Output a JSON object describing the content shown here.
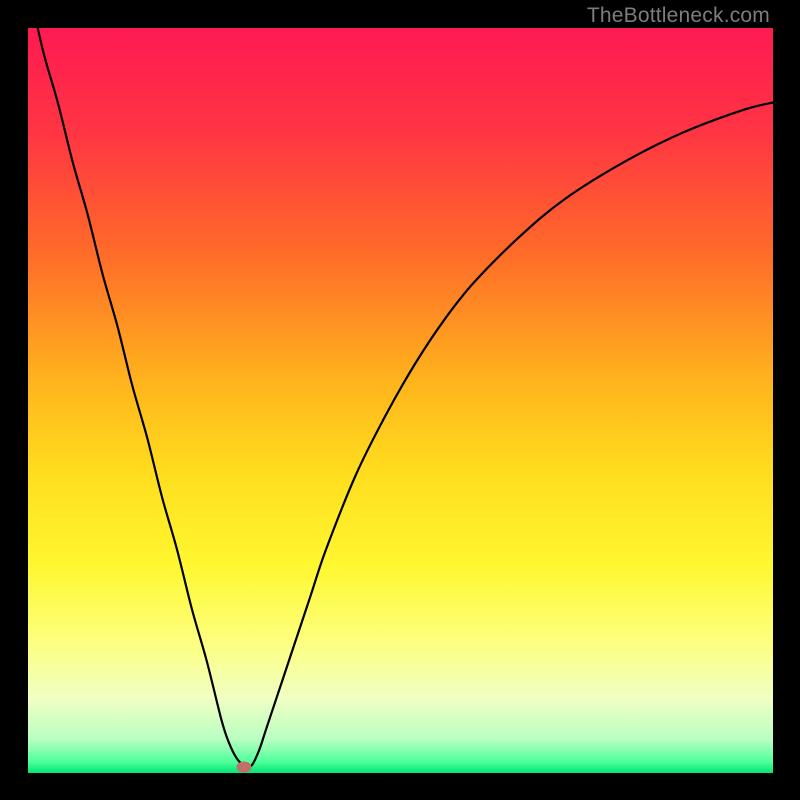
{
  "watermark": "TheBottleneck.com",
  "chart_data": {
    "type": "line",
    "title": "",
    "xlabel": "",
    "ylabel": "",
    "xlim": [
      0,
      100
    ],
    "ylim": [
      0,
      100
    ],
    "series": [
      {
        "name": "bottleneck-curve",
        "x": [
          0,
          2,
          4,
          6,
          8,
          10,
          12,
          14,
          16,
          18,
          20,
          22,
          24,
          26,
          27,
          28,
          29,
          30,
          31,
          32,
          34,
          36,
          38,
          40,
          44,
          48,
          52,
          56,
          60,
          66,
          72,
          80,
          88,
          96,
          100
        ],
        "y": [
          106,
          97,
          90,
          82,
          75,
          67,
          60,
          52,
          45,
          37,
          30,
          22,
          15,
          7,
          4,
          2,
          1,
          1,
          3,
          6,
          12,
          18,
          24,
          30,
          40,
          48,
          55,
          61,
          66,
          72,
          77,
          82,
          86,
          89,
          90
        ]
      }
    ],
    "marker": {
      "x": 29,
      "y": 0.8,
      "name": "minimum-point"
    },
    "gradient_stops": [
      {
        "offset": 0.0,
        "color": "#ff1a52"
      },
      {
        "offset": 0.14,
        "color": "#ff3543"
      },
      {
        "offset": 0.3,
        "color": "#ff6a29"
      },
      {
        "offset": 0.48,
        "color": "#ffb61c"
      },
      {
        "offset": 0.6,
        "color": "#ffde1e"
      },
      {
        "offset": 0.72,
        "color": "#fff72f"
      },
      {
        "offset": 0.82,
        "color": "#fdff7b"
      },
      {
        "offset": 0.9,
        "color": "#f1ffc3"
      },
      {
        "offset": 0.955,
        "color": "#b8ffc1"
      },
      {
        "offset": 0.985,
        "color": "#4fff9b"
      },
      {
        "offset": 1.0,
        "color": "#00e574"
      }
    ]
  }
}
